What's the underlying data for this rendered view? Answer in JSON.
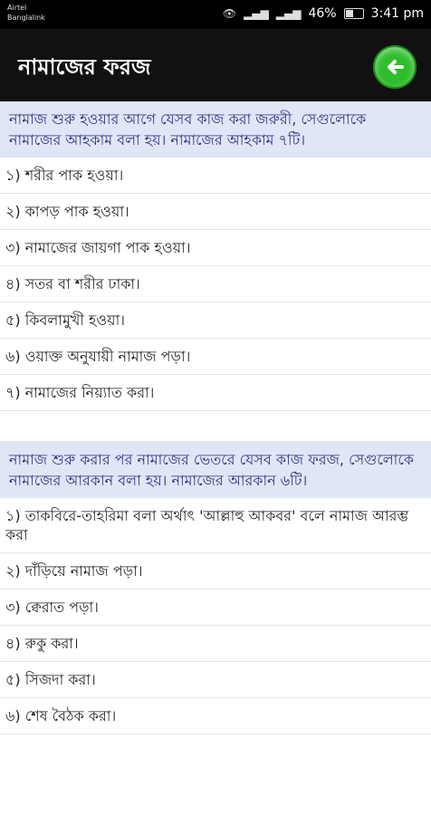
{
  "status": {
    "carrier_line1": "Airtel",
    "carrier_line2": "Banglalink",
    "battery_percent": "46%",
    "battery_fraction": 0.46,
    "time": "3:41 pm"
  },
  "appbar": {
    "title": "নামাজের ফরজ"
  },
  "sections": [
    {
      "intro": "নামাজ শুরু হওয়ার আগে যেসব কাজ করা জরুরী, সেগুলোকে নামাজের আহকাম বলা হয়। নামাজের আহকাম ৭টি।",
      "items": [
        "১) শরীর পাক হওয়া।",
        "২) কাপড় পাক হওয়া।",
        "৩) নামাজের জায়গা পাক হওয়া।",
        "৪) সতর বা শরীর ঢাকা।",
        "৫) কিবলামুখী হওয়া।",
        "৬) ওয়াক্ত অনুযায়ী নামাজ পড়া।",
        "৭) নামাজের নিয়্যাত করা।"
      ]
    },
    {
      "intro": "নামাজ শুরু করার পর নামাজের ভেতরে যেসব কাজ ফরজ, সেগুলোকে নামাজের আরকান বলা হয়। নামাজের আরকান ৬টি।",
      "items": [
        "১) তাকবিরে-তাহরিমা বলা অর্থাৎ 'আল্লাহু আকবর' বলে নামাজ আরম্ভ করা",
        "২) দাঁড়িয়ে নামাজ পড়া।",
        "৩) ক্বেরাত পড়া।",
        "৪) রুকু করা।",
        "৫) সিজদা করা।",
        "৬) শেষ বৈঠক করা।"
      ]
    }
  ]
}
